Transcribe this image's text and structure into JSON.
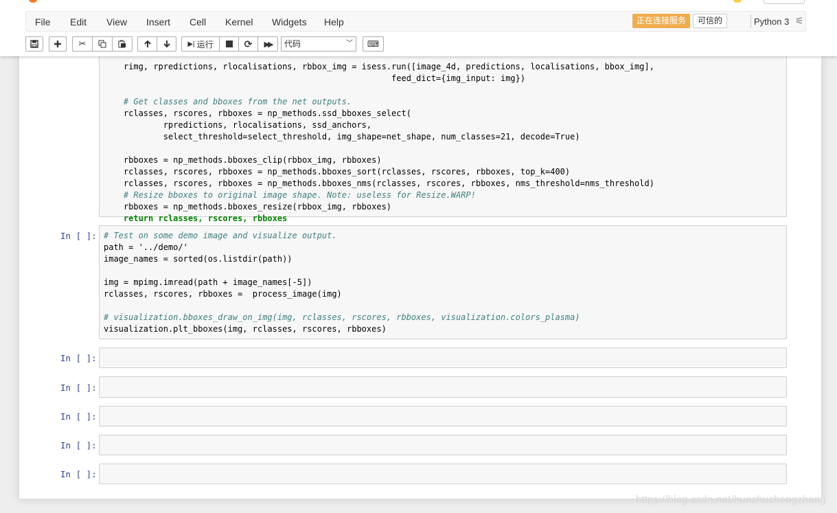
{
  "menu": [
    "File",
    "Edit",
    "View",
    "Insert",
    "Cell",
    "Kernel",
    "Widgets",
    "Help"
  ],
  "status": {
    "connecting": "正在连接服务",
    "trusted": "可信的",
    "kernel": "Python 3"
  },
  "toolbar": {
    "run_label": "运行",
    "cell_type": "代码"
  },
  "cells": {
    "first_lines": [
      "    rimg, rpredictions, rlocalisations, rbbox_img = isess.run([image_4d, predictions, localisations, bbox_img],",
      "                                                          feed_dict={img_input: img})",
      "",
      "    # Get classes and bboxes from the net outputs.",
      "    rclasses, rscores, rbboxes = np_methods.ssd_bboxes_select(",
      "            rpredictions, rlocalisations, ssd_anchors,",
      "            select_threshold=select_threshold, img_shape=net_shape, num_classes=21, decode=True)",
      "",
      "    rbboxes = np_methods.bboxes_clip(rbbox_img, rbboxes)",
      "    rclasses, rscores, rbboxes = np_methods.bboxes_sort(rclasses, rscores, rbboxes, top_k=400)",
      "    rclasses, rscores, rbboxes = np_methods.bboxes_nms(rclasses, rscores, rbboxes, nms_threshold=nms_threshold)",
      "    # Resize bboxes to original image shape. Note: useless for Resize.WARP!",
      "    rbboxes = np_methods.bboxes_resize(rbbox_img, rbboxes)",
      "    return rclasses, rscores, rbboxes"
    ],
    "second_prompt": "In [ ]:",
    "second_lines": [
      "# Test on some demo image and visualize output.",
      "path = '../demo/'",
      "image_names = sorted(os.listdir(path))",
      "",
      "img = mpimg.imread(path + image_names[-5])",
      "rclasses, rscores, rbboxes =  process_image(img)",
      "",
      "# visualization.bboxes_draw_on_img(img, rclasses, rscores, rbboxes, visualization.colors_plasma)",
      "visualization.plt_bboxes(img, rclasses, rscores, rbboxes)"
    ],
    "empty_prompts": [
      "In [ ]:",
      "In [ ]:",
      "In [ ]:",
      "In [ ]:",
      "In [ ]:"
    ]
  },
  "watermark": "https://blog.csdn.net/huachuchengzhang",
  "colors": {
    "comment": "#408080",
    "keyword": "#008000",
    "prompt": "#303f9f",
    "badge_warning": "#f0ad4e"
  }
}
